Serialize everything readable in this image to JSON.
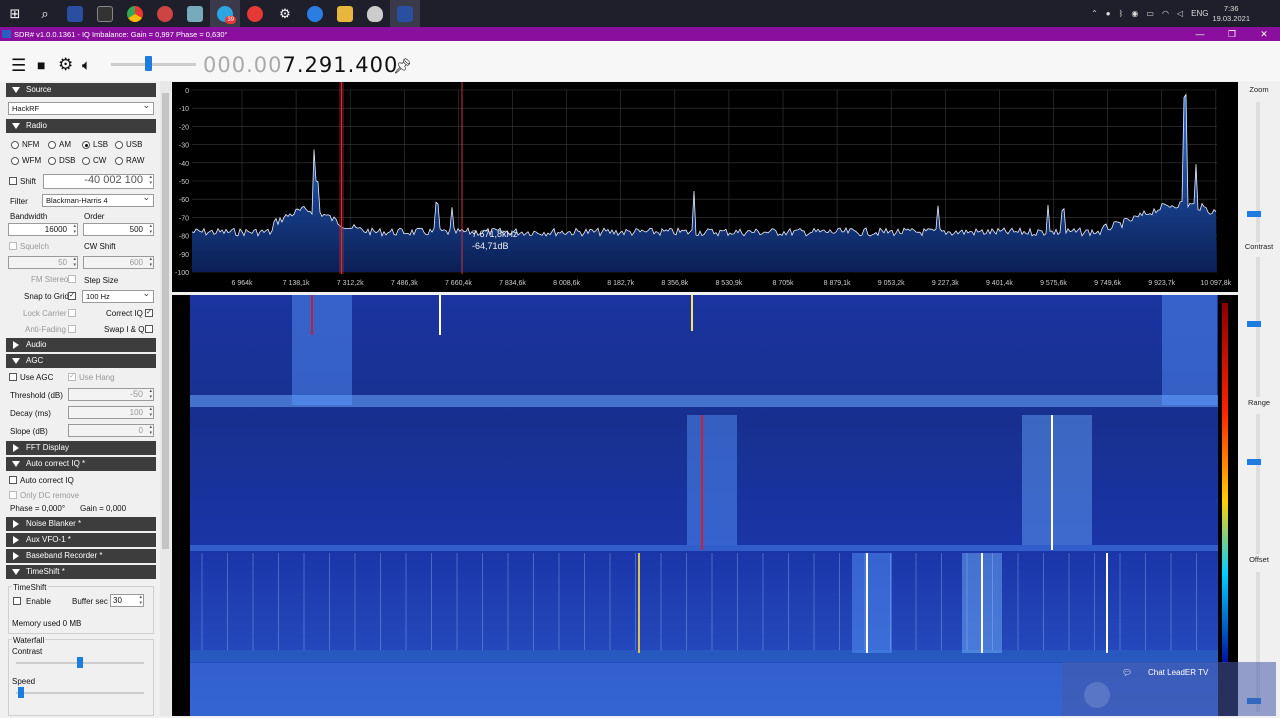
{
  "taskbar": {
    "icons": [
      "windows-start-icon",
      "search-icon",
      "app-icon",
      "terminal-icon",
      "chrome-icon",
      "app-icon",
      "app-icon",
      "telegram-icon",
      "yandex-icon",
      "gear-icon",
      "app-icon",
      "folder-icon",
      "shield-icon",
      "sdr-icon"
    ],
    "telegram_badge": "39",
    "lang": "ENG",
    "time": "7:36",
    "date": "19.03.2021"
  },
  "window": {
    "title": "SDR# v1.0.0.1361 - IQ Imbalance: Gain = 0,997 Phase = 0,630°"
  },
  "toolbar": {
    "frequency_dim": "000.00",
    "frequency_main": "7.291.400"
  },
  "panel": {
    "source": {
      "header": "Source",
      "device": "HackRF"
    },
    "radio": {
      "header": "Radio",
      "modes_row1": [
        "NFM",
        "AM",
        "LSB",
        "USB"
      ],
      "modes_row2": [
        "WFM",
        "DSB",
        "CW",
        "RAW"
      ],
      "selected_mode": "LSB",
      "shift_label": "Shift",
      "shift_value": "-40 002 100",
      "filter_label": "Filter",
      "filter_value": "Blackman-Harris 4",
      "bandwidth_label": "Bandwidth",
      "bandwidth_value": "16000",
      "order_label": "Order",
      "order_value": "500",
      "squelch_label": "Squelch",
      "squelch_value": "50",
      "cw_shift_label": "CW Shift",
      "cw_shift_value": "600",
      "fm_stereo_label": "FM Stereo",
      "step_size_label": "Step Size",
      "snap_label": "Snap to Grid",
      "snap_value": "100 Hz",
      "lock_carrier_label": "Lock Carrier",
      "correct_iq_label": "Correct IQ",
      "anti_fading_label": "Anti-Fading",
      "swap_iq_label": "Swap I & Q"
    },
    "audio": {
      "header": "Audio"
    },
    "agc": {
      "header": "AGC",
      "use_agc_label": "Use AGC",
      "use_hang_label": "Use Hang",
      "threshold_label": "Threshold (dB)",
      "threshold_value": "-50",
      "decay_label": "Decay (ms)",
      "decay_value": "100",
      "slope_label": "Slope (dB)",
      "slope_value": "0"
    },
    "fft": {
      "header": "FFT Display"
    },
    "auto_iq": {
      "header": "Auto correct IQ *",
      "auto_label": "Auto correct IQ",
      "dc_label": "Only DC remove",
      "phase_text": "Phase = 0,000°",
      "gain_text": "Gain = 0,000"
    },
    "noise": {
      "header": "Noise Blanker *"
    },
    "aux": {
      "header": "Aux VFO-1 *"
    },
    "baseband": {
      "header": "Baseband Recorder *"
    },
    "timeshift": {
      "header": "TimeShift *",
      "group_label": "TimeShift",
      "enable_label": "Enable",
      "buffer_label": "Buffer sec",
      "buffer_value": "30",
      "memory_text": "Memory used 0 MB",
      "waterfall_label": "Waterfall",
      "contrast_label": "Contrast",
      "speed_label": "Speed",
      "contrast_level": 0.5,
      "speed_level": 0.02
    }
  },
  "spectrum": {
    "y_ticks": [
      "0",
      "-10",
      "-20",
      "-30",
      "-40",
      "-50",
      "-60",
      "-70",
      "-80",
      "-90",
      "-100"
    ],
    "x_ticks": [
      "6 964k",
      "7 138,1k",
      "7 312,2k",
      "7 486,3k",
      "7 660,4k",
      "7 834,6k",
      "8 008,6k",
      "8 182,7k",
      "8 356,8k",
      "8 530,9k",
      "8 705k",
      "8 879,1k",
      "9 053,2k",
      "9 227,3k",
      "9 401,4k",
      "9 575,6k",
      "9 749,6k",
      "9 923,7k",
      "10 097,8k"
    ],
    "cursor_freq": "7 671,8kHz",
    "cursor_level": "-64,71dB"
  },
  "rightbar": {
    "zoom_label": "Zoom",
    "contrast_label": "Contrast",
    "range_label": "Range",
    "offset_label": "Offset"
  },
  "overlay": {
    "text": "Chat LeadER TV"
  }
}
